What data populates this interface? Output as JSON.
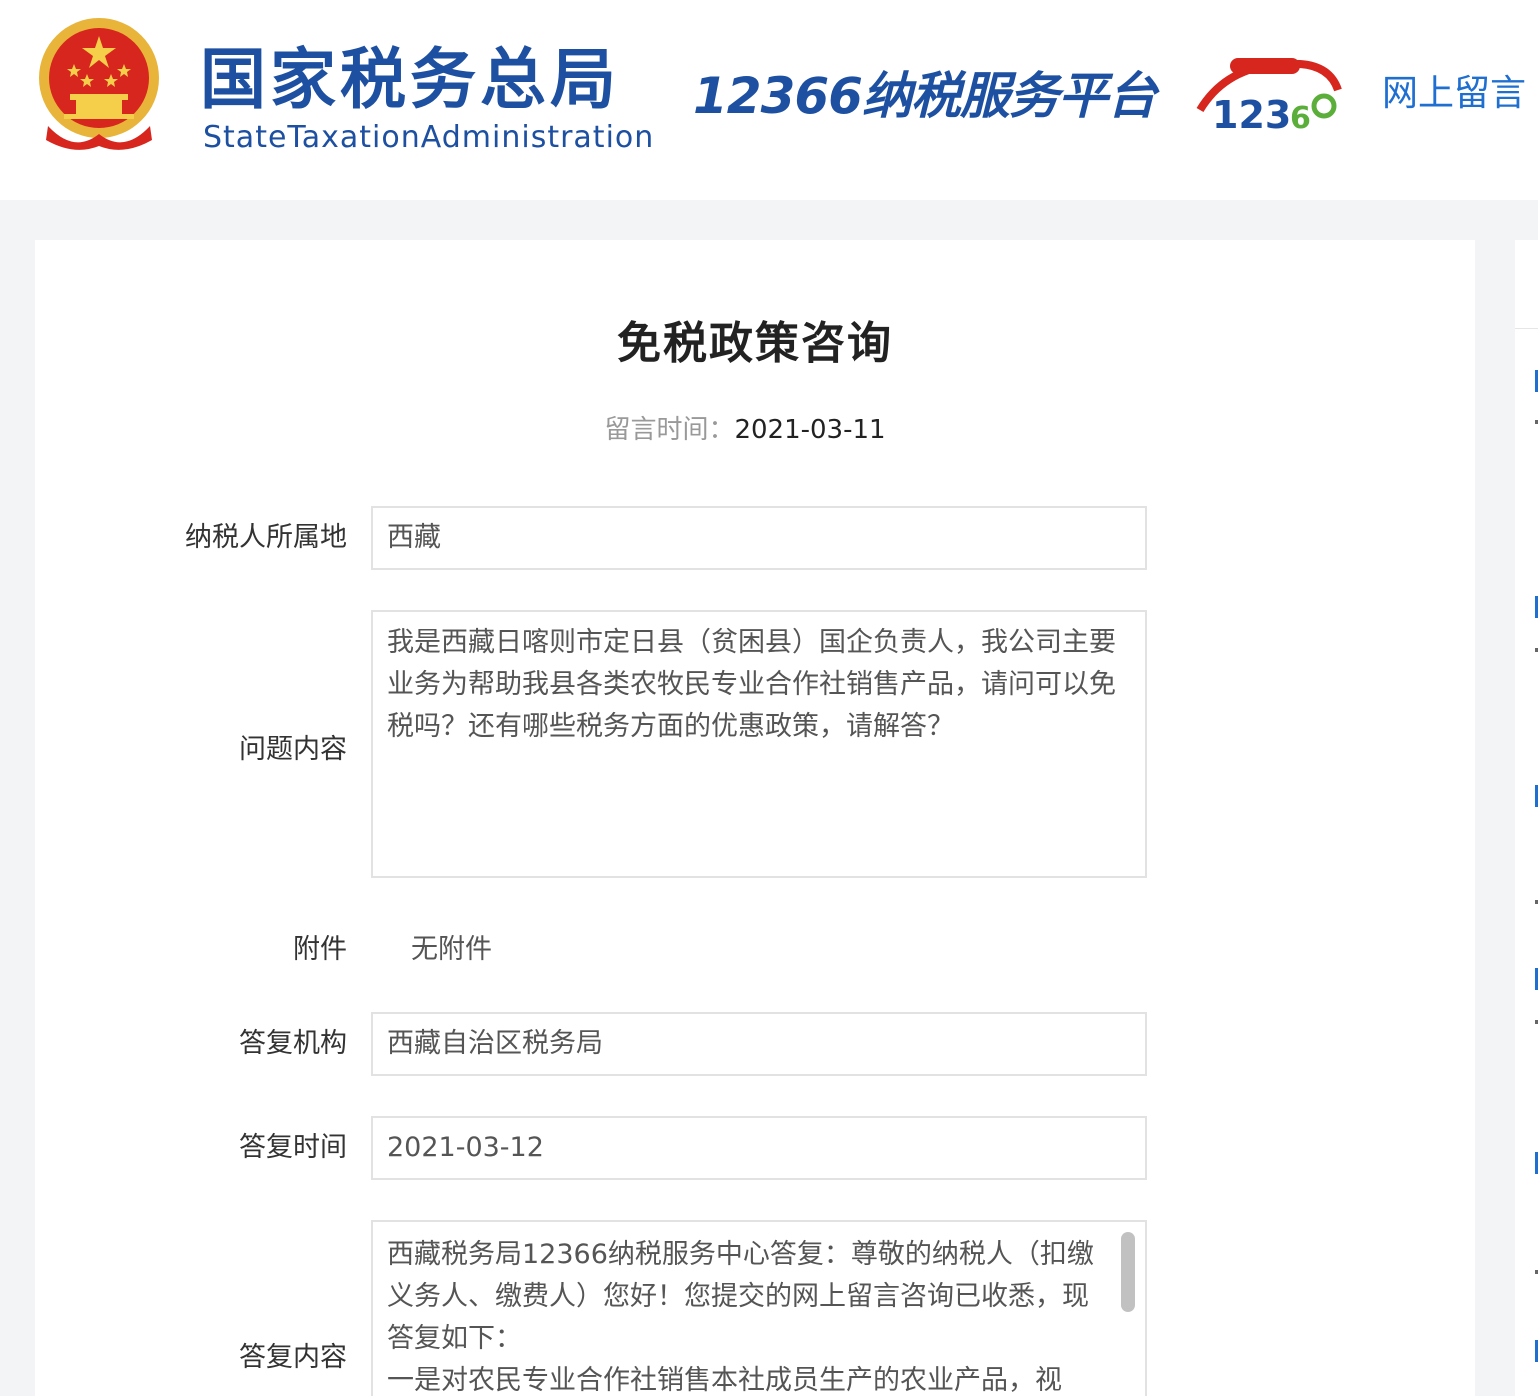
{
  "header": {
    "brand_cn": "国家税务总局",
    "brand_en": "StateTaxationAdministration",
    "platform": "12366纳税服务平台",
    "nav_link": "网上留言"
  },
  "article": {
    "title": "免税政策咨询",
    "time_label": "留言时间：",
    "time_value": "2021-03-11"
  },
  "form": {
    "location": {
      "label": "纳税人所属地",
      "value": "西藏"
    },
    "question": {
      "label": "问题内容",
      "value": "我是西藏日喀则市定日县（贫困县）国企负责人，我公司主要业务为帮助我县各类农牧民专业合作社销售产品，请问可以免税吗？还有哪些税务方面的优惠政策，请解答？"
    },
    "attachment": {
      "label": "附件",
      "value": "无附件"
    },
    "agency": {
      "label": "答复机构",
      "value": "西藏自治区税务局"
    },
    "reply_time": {
      "label": "答复时间",
      "value": "2021-03-12"
    },
    "reply_content": {
      "label": "答复内容",
      "line1": "西藏税务局12366纳税服务中心答复：尊敬的纳税人（扣缴义务人、缴费人）您好！您提交的网上留言咨询已收悉，现答复如下：",
      "line2": "一是对农民专业合作社销售本社成员生产的农业产品，视"
    }
  },
  "colors": {
    "brand_blue": "#1e50a2",
    "link_blue": "#1f6fd1",
    "emblem_red": "#d7261e",
    "emblem_gold": "#f2c230"
  }
}
